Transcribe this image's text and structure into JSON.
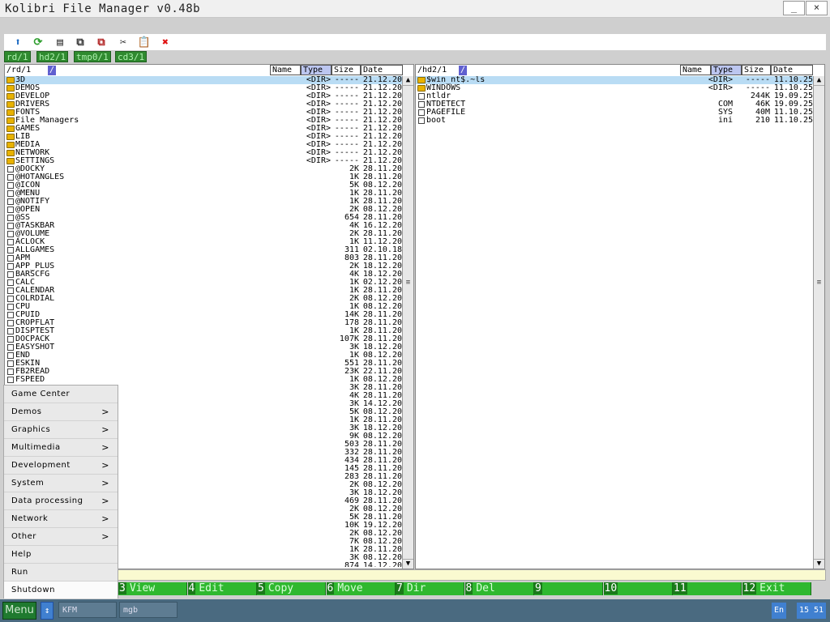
{
  "window": {
    "title": "Kolibri File Manager v0.48b",
    "min_label": "_",
    "close_label": "×"
  },
  "toolbar": {
    "icons": [
      "up-arrow-icon",
      "refresh-icon",
      "properties-icon",
      "copy-icon",
      "copy-move-icon",
      "cut-icon",
      "paste-icon",
      "delete-icon"
    ]
  },
  "drives": [
    "rd/1",
    "hd2/1",
    "tmp0/1",
    "cd3/1"
  ],
  "left_panel": {
    "path": "/rd/1",
    "slash": "/",
    "headers": {
      "name": "Name",
      "type": "Type",
      "size": "Size",
      "date": "Date"
    },
    "rows": [
      {
        "name": "3D",
        "type": "<DIR>",
        "size": "-----",
        "date": "21.12.20",
        "dir": true
      },
      {
        "name": "DEMOS",
        "type": "<DIR>",
        "size": "-----",
        "date": "21.12.20",
        "dir": true
      },
      {
        "name": "DEVELOP",
        "type": "<DIR>",
        "size": "-----",
        "date": "21.12.20",
        "dir": true
      },
      {
        "name": "DRIVERS",
        "type": "<DIR>",
        "size": "-----",
        "date": "21.12.20",
        "dir": true
      },
      {
        "name": "FONTS",
        "type": "<DIR>",
        "size": "-----",
        "date": "21.12.20",
        "dir": true
      },
      {
        "name": "File Managers",
        "type": "<DIR>",
        "size": "-----",
        "date": "21.12.20",
        "dir": true
      },
      {
        "name": "GAMES",
        "type": "<DIR>",
        "size": "-----",
        "date": "21.12.20",
        "dir": true
      },
      {
        "name": "LIB",
        "type": "<DIR>",
        "size": "-----",
        "date": "21.12.20",
        "dir": true
      },
      {
        "name": "MEDIA",
        "type": "<DIR>",
        "size": "-----",
        "date": "21.12.20",
        "dir": true
      },
      {
        "name": "NETWORK",
        "type": "<DIR>",
        "size": "-----",
        "date": "21.12.20",
        "dir": true
      },
      {
        "name": "SETTINGS",
        "type": "<DIR>",
        "size": "-----",
        "date": "21.12.20",
        "dir": true
      },
      {
        "name": "@DOCKY",
        "type": "",
        "size": "2K",
        "date": "28.11.20",
        "dir": false
      },
      {
        "name": "@HOTANGLES",
        "type": "",
        "size": "1K",
        "date": "28.11.20",
        "dir": false
      },
      {
        "name": "@ICON",
        "type": "",
        "size": "5K",
        "date": "08.12.20",
        "dir": false
      },
      {
        "name": "@MENU",
        "type": "",
        "size": "1K",
        "date": "28.11.20",
        "dir": false
      },
      {
        "name": "@NOTIFY",
        "type": "",
        "size": "1K",
        "date": "28.11.20",
        "dir": false
      },
      {
        "name": "@OPEN",
        "type": "",
        "size": "2K",
        "date": "08.12.20",
        "dir": false
      },
      {
        "name": "@SS",
        "type": "",
        "size": "654",
        "date": "28.11.20",
        "dir": false
      },
      {
        "name": "@TASKBAR",
        "type": "",
        "size": "4K",
        "date": "16.12.20",
        "dir": false
      },
      {
        "name": "@VOLUME",
        "type": "",
        "size": "2K",
        "date": "28.11.20",
        "dir": false
      },
      {
        "name": "ACLOCK",
        "type": "",
        "size": "1K",
        "date": "11.12.20",
        "dir": false
      },
      {
        "name": "ALLGAMES",
        "type": "",
        "size": "311",
        "date": "02.10.18",
        "dir": false
      },
      {
        "name": "APM",
        "type": "",
        "size": "803",
        "date": "28.11.20",
        "dir": false
      },
      {
        "name": "APP_PLUS",
        "type": "",
        "size": "2K",
        "date": "18.12.20",
        "dir": false
      },
      {
        "name": "BARSCFG",
        "type": "",
        "size": "4K",
        "date": "18.12.20",
        "dir": false
      },
      {
        "name": "CALC",
        "type": "",
        "size": "1K",
        "date": "02.12.20",
        "dir": false
      },
      {
        "name": "CALENDAR",
        "type": "",
        "size": "1K",
        "date": "28.11.20",
        "dir": false
      },
      {
        "name": "COLRDIAL",
        "type": "",
        "size": "2K",
        "date": "08.12.20",
        "dir": false
      },
      {
        "name": "CPU",
        "type": "",
        "size": "1K",
        "date": "08.12.20",
        "dir": false
      },
      {
        "name": "CPUID",
        "type": "",
        "size": "14K",
        "date": "28.11.20",
        "dir": false
      },
      {
        "name": "CROPFLAT",
        "type": "",
        "size": "178",
        "date": "28.11.20",
        "dir": false
      },
      {
        "name": "DISPTEST",
        "type": "",
        "size": "1K",
        "date": "28.11.20",
        "dir": false
      },
      {
        "name": "DOCPACK",
        "type": "",
        "size": "107K",
        "date": "28.11.20",
        "dir": false
      },
      {
        "name": "EASYSHOT",
        "type": "",
        "size": "3K",
        "date": "18.12.20",
        "dir": false
      },
      {
        "name": "END",
        "type": "",
        "size": "1K",
        "date": "08.12.20",
        "dir": false
      },
      {
        "name": "ESKIN",
        "type": "",
        "size": "551",
        "date": "28.11.20",
        "dir": false
      },
      {
        "name": "FB2READ",
        "type": "",
        "size": "23K",
        "date": "22.11.20",
        "dir": false
      },
      {
        "name": "FSPEED",
        "type": "",
        "size": "1K",
        "date": "08.12.20",
        "dir": false
      },
      {
        "name": "",
        "type": "",
        "size": "3K",
        "date": "28.11.20",
        "dir": false,
        "hidden": true
      },
      {
        "name": "",
        "type": "",
        "size": "4K",
        "date": "28.11.20",
        "dir": false,
        "hidden": true
      },
      {
        "name": "",
        "type": "",
        "size": "3K",
        "date": "14.12.20",
        "dir": false,
        "hidden": true
      },
      {
        "name": "",
        "type": "",
        "size": "5K",
        "date": "08.12.20",
        "dir": false,
        "hidden": true
      },
      {
        "name": "",
        "type": "",
        "size": "1K",
        "date": "28.11.20",
        "dir": false,
        "hidden": true
      },
      {
        "name": "",
        "type": "",
        "size": "3K",
        "date": "18.12.20",
        "dir": false,
        "hidden": true
      },
      {
        "name": "",
        "type": "",
        "size": "9K",
        "date": "08.12.20",
        "dir": false,
        "hidden": true
      },
      {
        "name": "",
        "type": "",
        "size": "503",
        "date": "28.11.20",
        "dir": false,
        "hidden": true
      },
      {
        "name": "",
        "type": "",
        "size": "332",
        "date": "28.11.20",
        "dir": false,
        "hidden": true
      },
      {
        "name": "",
        "type": "",
        "size": "434",
        "date": "28.11.20",
        "dir": false,
        "hidden": true
      },
      {
        "name": "",
        "type": "",
        "size": "145",
        "date": "28.11.20",
        "dir": false,
        "hidden": true
      },
      {
        "name": "",
        "type": "",
        "size": "283",
        "date": "28.11.20",
        "dir": false,
        "hidden": true
      },
      {
        "name": "",
        "type": "",
        "size": "2K",
        "date": "08.12.20",
        "dir": false,
        "hidden": true
      },
      {
        "name": "",
        "type": "",
        "size": "3K",
        "date": "18.12.20",
        "dir": false,
        "hidden": true
      },
      {
        "name": "",
        "type": "",
        "size": "469",
        "date": "28.11.20",
        "dir": false,
        "hidden": true
      },
      {
        "name": "",
        "type": "",
        "size": "2K",
        "date": "08.12.20",
        "dir": false,
        "hidden": true
      },
      {
        "name": "",
        "type": "",
        "size": "5K",
        "date": "28.11.20",
        "dir": false,
        "hidden": true
      },
      {
        "name": "",
        "type": "",
        "size": "10K",
        "date": "19.12.20",
        "dir": false,
        "hidden": true
      },
      {
        "name": "",
        "type": "",
        "size": "2K",
        "date": "08.12.20",
        "dir": false,
        "hidden": true
      },
      {
        "name": "",
        "type": "",
        "size": "7K",
        "date": "08.12.20",
        "dir": false,
        "hidden": true
      },
      {
        "name": "",
        "type": "",
        "size": "1K",
        "date": "28.11.20",
        "dir": false,
        "hidden": true
      },
      {
        "name": "",
        "type": "",
        "size": "3K",
        "date": "08.12.20",
        "dir": false,
        "hidden": true
      },
      {
        "name": "",
        "type": "",
        "size": "874",
        "date": "14.12.20",
        "dir": false,
        "hidden": true
      }
    ]
  },
  "right_panel": {
    "path": "/hd2/1",
    "slash": "/",
    "headers": {
      "name": "Name",
      "type": "Type",
      "size": "Size",
      "date": "Date"
    },
    "rows": [
      {
        "name": "$win_nt$.~ls",
        "type": "<DIR>",
        "size": "-----",
        "date": "11.10.25",
        "dir": true
      },
      {
        "name": "WINDOWS",
        "type": "<DIR>",
        "size": "-----",
        "date": "11.10.25",
        "dir": true
      },
      {
        "name": "ntldr",
        "type": "",
        "size": "244K",
        "date": "19.09.25",
        "dir": false
      },
      {
        "name": "NTDETECT",
        "type": "COM",
        "size": "46K",
        "date": "19.09.25",
        "dir": false
      },
      {
        "name": "PAGEFILE",
        "type": "SYS",
        "size": "40M",
        "date": "11.10.25",
        "dir": false
      },
      {
        "name": "boot",
        "type": "ini",
        "size": "210",
        "date": "11.10.25",
        "dir": false
      }
    ]
  },
  "function_keys": [
    {
      "num": "3",
      "label": "View"
    },
    {
      "num": "4",
      "label": "Edit"
    },
    {
      "num": "5",
      "label": "Copy"
    },
    {
      "num": "6",
      "label": "Move"
    },
    {
      "num": "7",
      "label": "Dir"
    },
    {
      "num": "8",
      "label": "Del"
    },
    {
      "num": "9",
      "label": ""
    },
    {
      "num": "10",
      "label": ""
    },
    {
      "num": "11",
      "label": ""
    },
    {
      "num": "12",
      "label": "Exit"
    }
  ],
  "start_menu": [
    {
      "label": "Game Center",
      "arrow": ""
    },
    {
      "label": "Demos",
      "arrow": ">"
    },
    {
      "label": "Graphics",
      "arrow": ">"
    },
    {
      "label": "Multimedia",
      "arrow": ">"
    },
    {
      "label": "Development",
      "arrow": ">"
    },
    {
      "label": "System",
      "arrow": ">"
    },
    {
      "label": "Data processing",
      "arrow": ">"
    },
    {
      "label": "Network",
      "arrow": ">"
    },
    {
      "label": "Other",
      "arrow": ">"
    },
    {
      "label": "Help",
      "arrow": ""
    },
    {
      "label": "Run",
      "arrow": ""
    },
    {
      "label": "Shutdown",
      "arrow": ""
    }
  ],
  "taskbar": {
    "menu_label": "Menu",
    "swap_label": "↕",
    "tasks": [
      "KFM",
      "mgb"
    ],
    "lang": "En",
    "clock": "15 51"
  }
}
